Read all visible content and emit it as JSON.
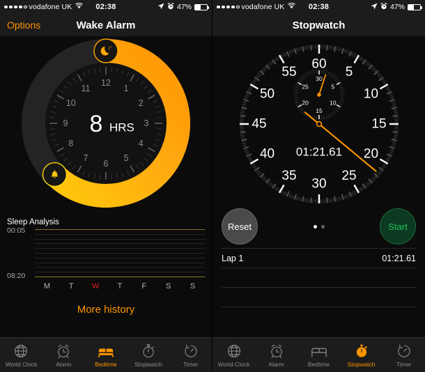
{
  "status_bar": {
    "carrier": "vodafone UK",
    "signal_dots_filled": 4,
    "signal_dots_total": 5,
    "wifi_icon": "wifi-icon",
    "time": "02:38",
    "location_icon": "location-arrow-icon",
    "alarm_icon": "alarm-clock-icon",
    "battery_percent": "47%",
    "battery_level": 47
  },
  "left_screen": {
    "nav": {
      "left_button": "Options",
      "title": "Wake Alarm"
    },
    "dial": {
      "duration_value": "8",
      "duration_unit": "HRS",
      "bedtime_handle_icon": "moon-zzz-icon",
      "alarm_handle_icon": "bell-icon",
      "hour_labels": [
        "12",
        "1",
        "2",
        "3",
        "4",
        "5",
        "6",
        "7",
        "8",
        "9",
        "10",
        "11"
      ],
      "bedtime_hour": 12,
      "wake_hour": 8,
      "arc_color_start": "#ff9500",
      "arc_color_end": "#ffc40c",
      "track_color": "#2a2a2a"
    },
    "sleep_analysis": {
      "title": "Sleep Analysis",
      "top_label": "00:05",
      "bottom_label": "08:20",
      "days": [
        {
          "label": "M",
          "active": false
        },
        {
          "label": "T",
          "active": false
        },
        {
          "label": "W",
          "active": true
        },
        {
          "label": "T",
          "active": false
        },
        {
          "label": "F",
          "active": false
        },
        {
          "label": "S",
          "active": false
        },
        {
          "label": "S",
          "active": false
        }
      ],
      "active_day_color": "#e02020",
      "gridline_count": 9
    },
    "more_history_label": "More history"
  },
  "right_screen": {
    "nav": {
      "left_button": "",
      "title": "Stopwatch"
    },
    "stopwatch": {
      "elapsed": "01:21.61",
      "seconds_value": 21.61,
      "minutes_value": 1,
      "main_dial_labels": [
        "60",
        "5",
        "10",
        "15",
        "20",
        "25",
        "30",
        "35",
        "40",
        "45",
        "50",
        "55"
      ],
      "sub_dial_labels": [
        "30",
        "5",
        "10",
        "15",
        "20",
        "25"
      ],
      "hand_color": "#ff9500"
    },
    "controls": {
      "reset_label": "Reset",
      "start_label": "Start",
      "start_color": "#20c060",
      "page_dots": 2,
      "page_dot_active": 0
    },
    "laps": {
      "rows": [
        {
          "name": "Lap 1",
          "time": "01:21.61"
        }
      ]
    }
  },
  "tab_bar": {
    "left_active": "Bedtime",
    "right_active": "Stopwatch",
    "items": [
      {
        "label": "World Clock",
        "icon": "globe-icon"
      },
      {
        "label": "Alarm",
        "icon": "alarm-clock-icon"
      },
      {
        "label": "Bedtime",
        "icon": "bed-icon"
      },
      {
        "label": "Stopwatch",
        "icon": "stopwatch-icon"
      },
      {
        "label": "Timer",
        "icon": "timer-icon"
      }
    ],
    "active_color": "#ff9500",
    "inactive_color": "#8e8e8e"
  }
}
